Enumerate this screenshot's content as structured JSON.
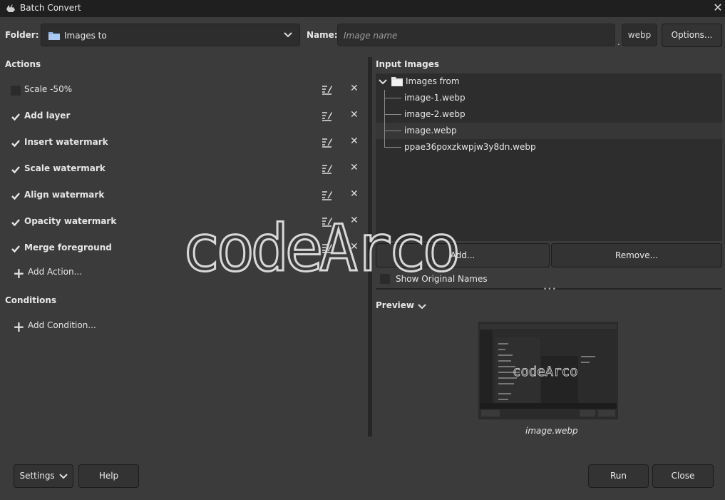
{
  "window": {
    "title": "Batch Convert"
  },
  "top": {
    "folder_label": "Folder:",
    "folder_value": "Images to",
    "name_label": "Name:",
    "name_placeholder": "Image name",
    "ext_dot": ".",
    "extension": "webp",
    "options_label": "Options..."
  },
  "actions": {
    "title": "Actions",
    "items": [
      {
        "label": "Scale -50%",
        "checked": false
      },
      {
        "label": "Add layer",
        "checked": true
      },
      {
        "label": "Insert watermark",
        "checked": true
      },
      {
        "label": "Scale watermark",
        "checked": true
      },
      {
        "label": "Align watermark",
        "checked": true
      },
      {
        "label": "Opacity watermark",
        "checked": true
      },
      {
        "label": "Merge foreground",
        "checked": true
      }
    ],
    "add_label": "Add Action..."
  },
  "conditions": {
    "title": "Conditions",
    "add_label": "Add Condition..."
  },
  "input": {
    "title": "Input Images",
    "root": "Images from",
    "files": [
      "image-1.webp",
      "image-2.webp",
      "image.webp",
      "ppae36poxzkwpjw3y8dn.webp"
    ],
    "add_label": "Add...",
    "remove_label": "Remove...",
    "show_original": "Show Original Names"
  },
  "preview": {
    "title": "Preview",
    "caption": "image.webp",
    "thumb_watermark": "codeArco"
  },
  "bottom": {
    "settings": "Settings",
    "help": "Help",
    "run": "Run",
    "close": "Close"
  },
  "watermark": "codeArco",
  "colors": {
    "bg": "#3b3b3b",
    "field": "#2d2d2d",
    "titlebar": "#1f1f1f",
    "folder_icon": "#8ab4e8"
  }
}
